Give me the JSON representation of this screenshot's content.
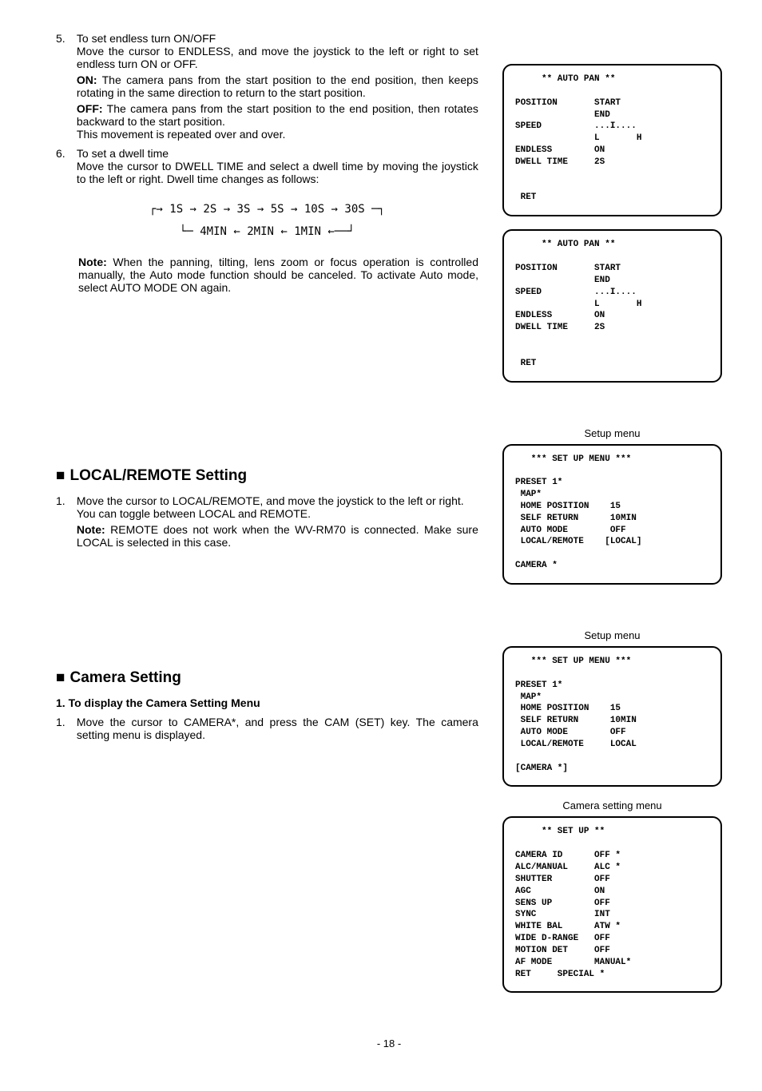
{
  "top": {
    "item5": {
      "num": "5.",
      "title": "To set endless turn ON/OFF",
      "p1": "Move the cursor to ENDLESS, and move the joystick to the left or right to set endless turn ON or OFF.",
      "on_label": "ON:",
      "on_text": " The camera pans from the start position to the end position, then keeps rotating in the same direction to return to the start position.",
      "off_label": "OFF:",
      "off_text": " The camera pans from the start position to the end position, then rotates backward to the start position.",
      "off_text2": "This movement is repeated over and over."
    },
    "item6": {
      "num": "6.",
      "title": "To set a dwell time",
      "p1": "Move the cursor to DWELL TIME and select a dwell time by moving the joystick to the left or right. Dwell time changes as follows:"
    },
    "chain_line1": "┌→ 1S → 2S → 3S → 5S → 10S → 30S ─┐",
    "chain_line2": "└─ 4MIN  ←   2MIN   ←   1MIN ←──┘",
    "note_label": "Note:",
    "note_text": " When the panning, tilting, lens zoom or focus operation is controlled manually, the Auto mode function should be canceled. To activate Auto mode, select AUTO MODE ON again."
  },
  "osd1": "     ** AUTO PAN **\n\nPOSITION       START\n               END\nSPEED          ...I....\n               L       H\nENDLESS        ON\nDWELL TIME     2S\n\n\n RET",
  "osd2": "     ** AUTO PAN **\n\nPOSITION       START\n               END\nSPEED          ...I....\n               L       H\nENDLESS        ON\nDWELL TIME     2S\n\n\n RET",
  "local": {
    "heading": "LOCAL/REMOTE Setting",
    "caption": "Setup menu",
    "num": "1.",
    "p1": "Move the cursor to LOCAL/REMOTE, and move the joystick to the left or right.",
    "p2": "You can toggle between LOCAL and REMOTE.",
    "note_label": "Note:",
    "note_text": " REMOTE does not work when the WV-RM70 is connected. Make sure LOCAL is selected in this case."
  },
  "osd3": "   *** SET UP MENU ***\n\nPRESET 1*\n MAP*\n HOME POSITION    15\n SELF RETURN      10MIN\n AUTO MODE        OFF\n LOCAL/REMOTE    [LOCAL]\n\nCAMERA *",
  "camera": {
    "heading": "Camera Setting",
    "caption1": "Setup menu",
    "subhead": "1. To display the Camera Setting Menu",
    "num": "1.",
    "p1": "Move the cursor to CAMERA*, and press the CAM (SET) key. The camera setting menu is displayed.",
    "caption2": "Camera setting menu"
  },
  "osd4": "   *** SET UP MENU ***\n\nPRESET 1*\n MAP*\n HOME POSITION    15\n SELF RETURN      10MIN\n AUTO MODE        OFF\n LOCAL/REMOTE     LOCAL\n\n[CAMERA *]",
  "osd5": "     ** SET UP **\n\nCAMERA ID      OFF *\nALC/MANUAL     ALC *\nSHUTTER        OFF\nAGC            ON\nSENS UP        OFF\nSYNC           INT\nWHITE BAL      ATW *\nWIDE D-RANGE   OFF\nMOTION DET     OFF\nAF MODE        MANUAL*\nRET     SPECIAL *",
  "page": "- 18 -"
}
